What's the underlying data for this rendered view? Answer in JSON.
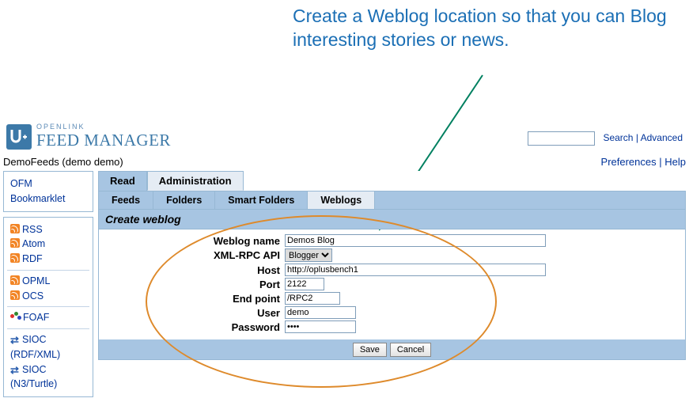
{
  "callout_text": "Create a Weblog location so that you can Blog interesting stories or news.",
  "logo": {
    "line1": "OPENLINK",
    "line2": "FEED MANAGER"
  },
  "top": {
    "search_value": "",
    "search_link": "Search",
    "advanced_link": "Advanced"
  },
  "user_line": {
    "left": "DemoFeeds (demo demo)",
    "prefs": "Preferences",
    "help": "Help"
  },
  "sidebar": {
    "bookmarklet": "OFM Bookmarklet",
    "items": [
      {
        "icon": "feed",
        "label": "RSS"
      },
      {
        "icon": "feed",
        "label": "Atom"
      },
      {
        "icon": "feed",
        "label": "RDF"
      }
    ],
    "items2": [
      {
        "icon": "feed",
        "label": "OPML"
      },
      {
        "icon": "feed",
        "label": "OCS"
      }
    ],
    "foaf": {
      "label": "FOAF"
    },
    "sioc1": {
      "label": "SIOC (RDF/XML)"
    },
    "sioc2": {
      "label": "SIOC (N3/Turtle)"
    }
  },
  "tabs1": [
    {
      "label": "Read",
      "active": false
    },
    {
      "label": "Administration",
      "active": true
    }
  ],
  "tabs2": [
    {
      "label": "Feeds",
      "active": false
    },
    {
      "label": "Folders",
      "active": false
    },
    {
      "label": "Smart Folders",
      "active": false
    },
    {
      "label": "Weblogs",
      "active": true
    }
  ],
  "panel_title": "Create weblog",
  "form": {
    "weblog_name": {
      "label": "Weblog name",
      "value": "Demos Blog"
    },
    "api": {
      "label": "XML-RPC API",
      "value": "Blogger"
    },
    "host": {
      "label": "Host",
      "value": "http://oplusbench1"
    },
    "port": {
      "label": "Port",
      "value": "2122"
    },
    "endpoint": {
      "label": "End point",
      "value": "/RPC2"
    },
    "user": {
      "label": "User",
      "value": "demo"
    },
    "password": {
      "label": "Password",
      "value": "****"
    }
  },
  "buttons": {
    "save": "Save",
    "cancel": "Cancel"
  }
}
